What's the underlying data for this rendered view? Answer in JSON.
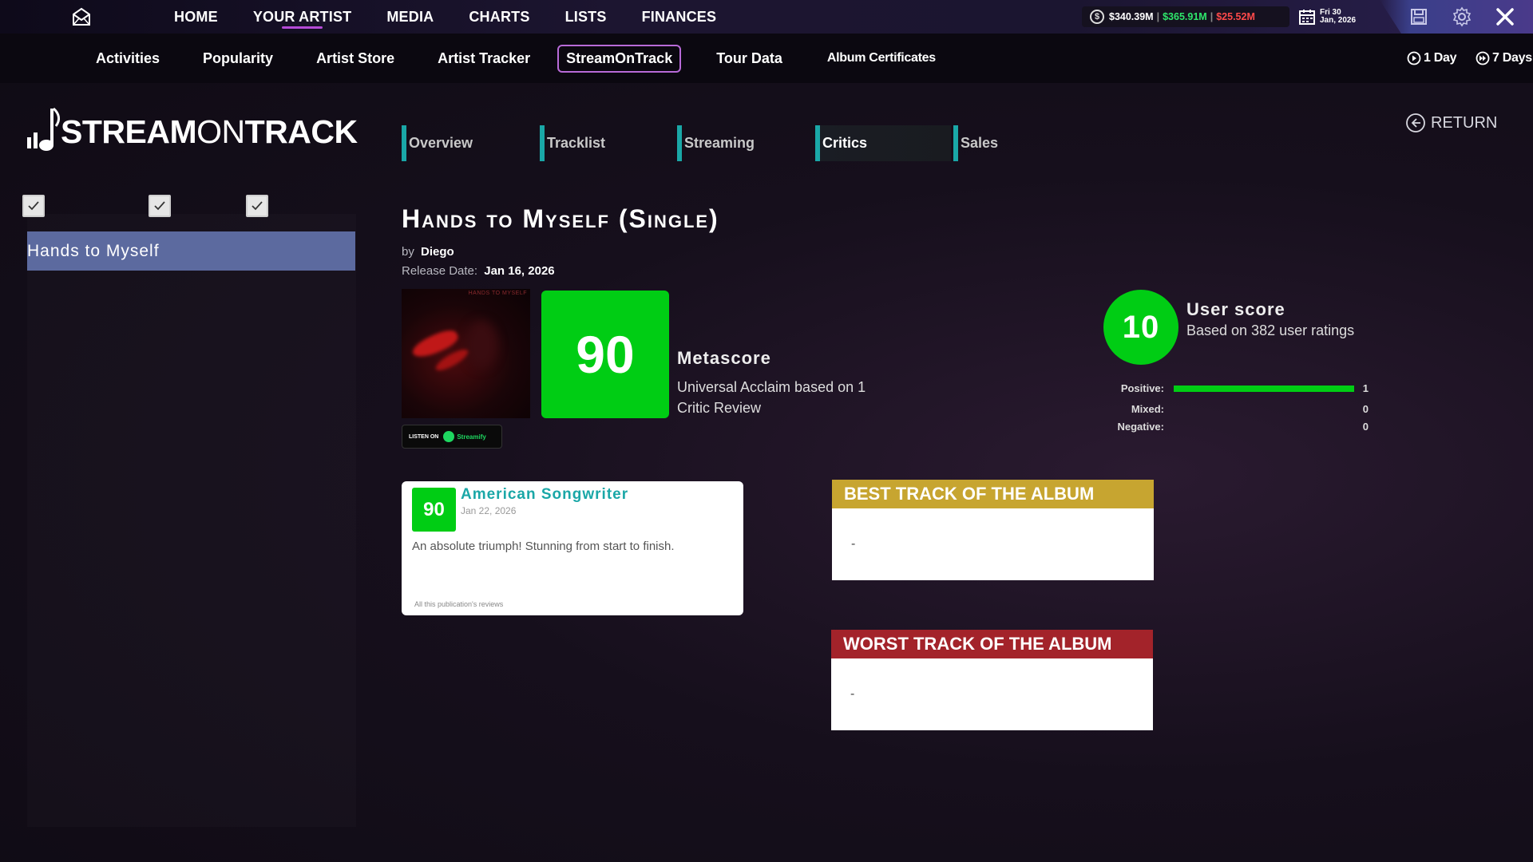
{
  "topnav": {
    "items": [
      {
        "label": "HOME"
      },
      {
        "label": "YOUR ARTIST"
      },
      {
        "label": "MEDIA"
      },
      {
        "label": "CHARTS"
      },
      {
        "label": "LISTS"
      },
      {
        "label": "FINANCES"
      }
    ],
    "active": "YOUR ARTIST"
  },
  "finance": {
    "balance": "$340.39M",
    "income": "$365.91M",
    "expenses": "$25.52M"
  },
  "date": {
    "line1": "Fri 30",
    "line2": "Jan, 2026"
  },
  "subnav": {
    "items": [
      {
        "label": "Activities"
      },
      {
        "label": "Popularity"
      },
      {
        "label": "Artist Store"
      },
      {
        "label": "Artist Tracker"
      },
      {
        "label": "StreamOnTrack"
      },
      {
        "label": "Tour Data"
      },
      {
        "label": "Album Certificates"
      }
    ],
    "active": "StreamOnTrack",
    "advance_1": "1 Day",
    "advance_7": "7 Days"
  },
  "logo": {
    "bold1": "STREAM",
    "thin": "ON",
    "bold2": "TRACK"
  },
  "tabs": [
    "Overview",
    "Tracklist",
    "Streaming",
    "Critics",
    "Sales"
  ],
  "active_tab": "Critics",
  "return_label": "RETURN",
  "sidebar": {
    "selected": "Hands to Myself"
  },
  "album": {
    "title": "Hands to Myself (Single)",
    "by_prefix": "by",
    "artist": "Diego",
    "release_prefix": "Release Date:",
    "release_date": "Jan 16, 2026",
    "cover_text": "HANDS TO MYSELF",
    "listen_prefix": "LISTEN ON",
    "listen_service": "Streamify"
  },
  "metascore": {
    "value": "90",
    "label": "Metascore",
    "description": "Universal Acclaim based on 1 Critic Review"
  },
  "userscore": {
    "value": "10",
    "label": "User score",
    "description": "Based on 382 user ratings",
    "distribution": [
      {
        "label": "Positive:",
        "count": "1",
        "fraction": 1.0
      },
      {
        "label": "Mixed:",
        "count": "0",
        "fraction": 0.0
      },
      {
        "label": "Negative:",
        "count": "0",
        "fraction": 0.0
      }
    ]
  },
  "review": {
    "score": "90",
    "publication": "American Songwriter",
    "date": "Jan 22, 2026",
    "text": "An absolute triumph! Stunning from start to finish.",
    "more_link": "All this publication's reviews"
  },
  "best_track": {
    "header": "BEST TRACK OF THE ALBUM",
    "value": "-",
    "color": "#c7a530"
  },
  "worst_track": {
    "header": "WORST TRACK OF THE ALBUM",
    "value": "-",
    "color": "#a3232a"
  },
  "colors": {
    "accent": "#b54ad6",
    "score_green": "#00cd14",
    "tab_bar": "#1aa7a7",
    "selected_item": "#5c6a9f"
  }
}
